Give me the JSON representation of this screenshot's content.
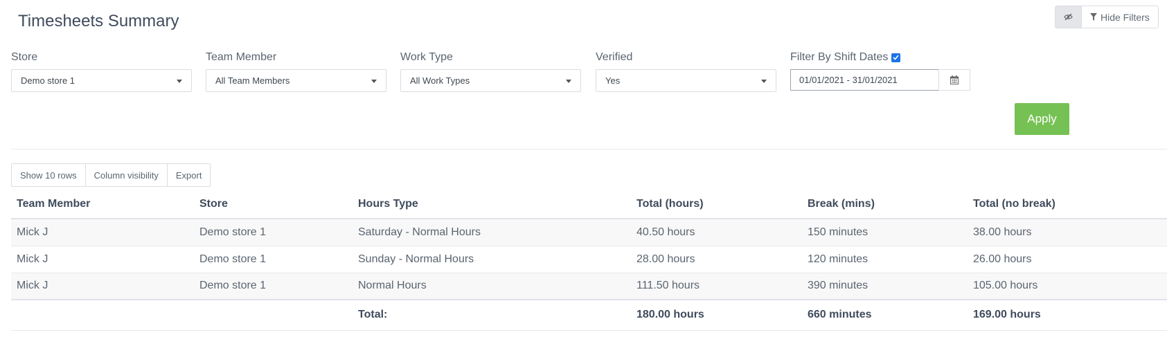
{
  "page": {
    "title": "Timesheets Summary"
  },
  "toolbar": {
    "hide_filters_label": "Hide Filters"
  },
  "filters": {
    "store": {
      "label": "Store",
      "value": "Demo store 1"
    },
    "team_member": {
      "label": "Team Member",
      "value": "All Team Members"
    },
    "work_type": {
      "label": "Work Type",
      "value": "All Work Types"
    },
    "verified": {
      "label": "Verified",
      "value": "Yes"
    },
    "shift_dates": {
      "label": "Filter By Shift Dates",
      "checked": true,
      "value": "01/01/2021 - 31/01/2021"
    },
    "apply_label": "Apply"
  },
  "table_buttons": {
    "show_rows": "Show 10 rows",
    "column_visibility": "Column visibility",
    "export": "Export"
  },
  "table": {
    "headers": [
      "Team Member",
      "Store",
      "Hours Type",
      "Total (hours)",
      "Break (mins)",
      "Total (no break)"
    ],
    "rows": [
      [
        "Mick J",
        "Demo store 1",
        "Saturday - Normal Hours",
        "40.50 hours",
        "150 minutes",
        "38.00 hours"
      ],
      [
        "Mick J",
        "Demo store 1",
        "Sunday - Normal Hours",
        "28.00 hours",
        "120 minutes",
        "26.00 hours"
      ],
      [
        "Mick J",
        "Demo store 1",
        "Normal Hours",
        "111.50 hours",
        "390 minutes",
        "105.00 hours"
      ]
    ],
    "footer": {
      "label": "Total:",
      "total_hours": "180.00 hours",
      "break_mins": "660 minutes",
      "total_no_break": "169.00 hours"
    }
  },
  "colors": {
    "apply_button": "#76c153",
    "checkbox": "#1a73e8",
    "title": "#3f4b5c"
  },
  "icons": [
    "eye-slash-icon",
    "filter-icon",
    "caret-down-icon",
    "check-icon",
    "calendar-icon"
  ]
}
